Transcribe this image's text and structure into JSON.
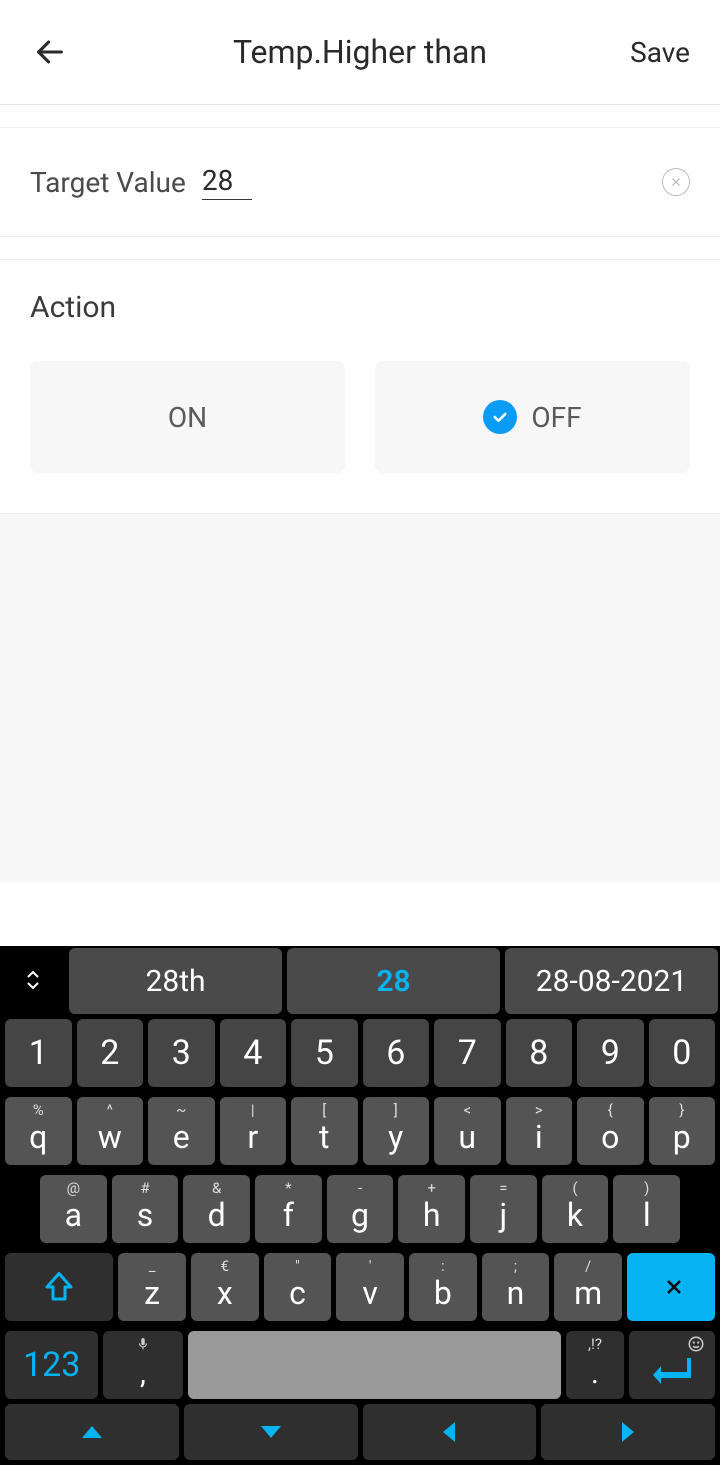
{
  "header": {
    "title": "Temp.Higher than",
    "save": "Save"
  },
  "target": {
    "label": "Target Value",
    "value": "28"
  },
  "action": {
    "label": "Action",
    "on": "ON",
    "off": "OFF",
    "selected": "off"
  },
  "suggestions": {
    "s1": "28th",
    "s2": "28",
    "s3": "28-08-2021"
  },
  "keys": {
    "row1": [
      "1",
      "2",
      "3",
      "4",
      "5",
      "6",
      "7",
      "8",
      "9",
      "0"
    ],
    "row2_top": [
      "%",
      "^",
      "~",
      "|",
      "[",
      "]",
      "<",
      ">",
      "{",
      "}"
    ],
    "row2": [
      "q",
      "w",
      "e",
      "r",
      "t",
      "y",
      "u",
      "i",
      "o",
      "p"
    ],
    "row3_top": [
      "@",
      "#",
      "&",
      "*",
      "-",
      "+",
      "=",
      "(",
      ")"
    ],
    "row3": [
      "a",
      "s",
      "d",
      "f",
      "g",
      "h",
      "j",
      "k",
      "l"
    ],
    "row4_top": [
      "_",
      "€",
      "\"",
      "'",
      ":",
      ";",
      "/"
    ],
    "row4": [
      "z",
      "x",
      "c",
      "v",
      "b",
      "n",
      "m"
    ],
    "numlabel": "123",
    "dot_sup": ",!?",
    "comma": ","
  }
}
